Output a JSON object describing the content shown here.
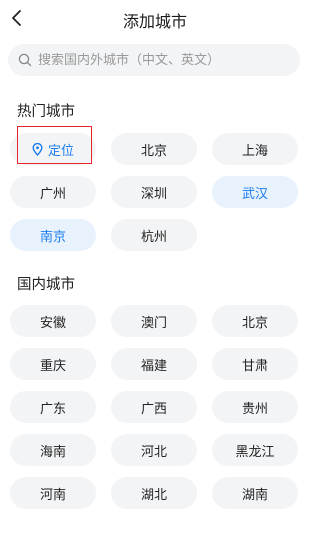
{
  "header": {
    "title": "添加城市"
  },
  "search": {
    "placeholder": "搜索国内外城市（中文、英文）"
  },
  "hot": {
    "title": "热门城市",
    "locate_label": "定位",
    "cities": [
      "北京",
      "上海",
      "广州",
      "深圳",
      "武汉",
      "南京",
      "杭州"
    ],
    "selected": [
      "武汉",
      "南京"
    ]
  },
  "domestic": {
    "title": "国内城市",
    "cities": [
      "安徽",
      "澳门",
      "北京",
      "重庆",
      "福建",
      "甘肃",
      "广东",
      "广西",
      "贵州",
      "海南",
      "河北",
      "黑龙江",
      "河南",
      "湖北",
      "湖南"
    ]
  },
  "colors": {
    "accent": "#1b7cf0",
    "chip_bg": "#f3f4f6",
    "selected_bg": "#e8f2fd",
    "highlight_outline": "#e5242b"
  }
}
